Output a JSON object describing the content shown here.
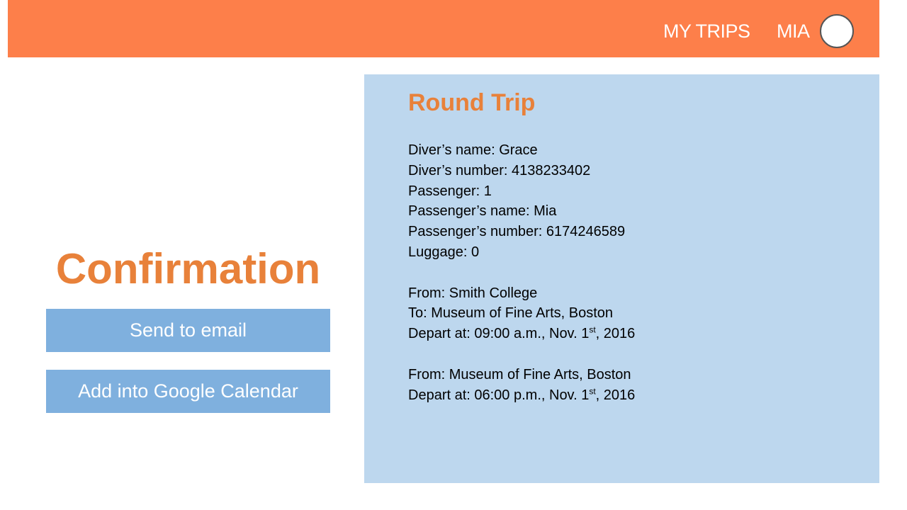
{
  "header": {
    "nav_my_trips": "MY TRIPS",
    "user_name": "MIA"
  },
  "page": {
    "title": "Confirmation"
  },
  "actions": {
    "send_email": "Send to email",
    "add_calendar": "Add into Google Calendar"
  },
  "trip": {
    "type": "Round Trip",
    "driver_name": "Diver’s name: Grace",
    "driver_number": "Diver’s number: 4138233402",
    "passenger_count": "Passenger: 1",
    "passenger_name": "Passenger’s name: Mia",
    "passenger_number": "Passenger’s number: 6174246589",
    "luggage": "Luggage: 0",
    "outbound": {
      "from": "From: Smith College",
      "to": "To: Museum of Fine Arts, Boston",
      "depart_prefix": "Depart at: 09:00 a.m., Nov. 1",
      "depart_sup": "st",
      "depart_suffix": ", 2016"
    },
    "return": {
      "from": "From: Museum of Fine Arts, Boston",
      "depart_prefix": "Depart at: 06:00 p.m., Nov. 1",
      "depart_sup": "st",
      "depart_suffix": ", 2016"
    }
  },
  "colors": {
    "header_bg": "#fd7f4a",
    "accent_orange": "#e8813a",
    "button_blue": "#7fb0de",
    "panel_blue": "#bdd7ee"
  }
}
